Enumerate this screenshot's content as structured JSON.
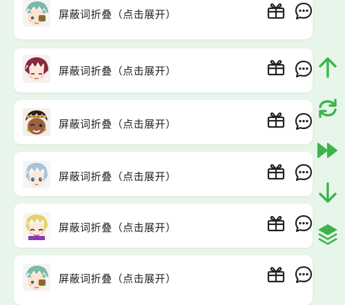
{
  "colors": {
    "background": "#e7f5ea",
    "card": "#ffffff",
    "accent_green": "#3cb44b",
    "icon_dark": "#222222"
  },
  "posts": [
    {
      "text": "屏蔽词折叠（点击展开）",
      "avatar": "teal-hair-avatar"
    },
    {
      "text": "屏蔽词折叠（点击展开）",
      "avatar": "red-hair-avatar"
    },
    {
      "text": "屏蔽词折叠（点击展开）",
      "avatar": "dark-skin-avatar"
    },
    {
      "text": "屏蔽词折叠（点击展开）",
      "avatar": "light-blue-hair-avatar"
    },
    {
      "text": "屏蔽词折叠（点击展开）",
      "avatar": "blonde-hair-avatar"
    },
    {
      "text": "屏蔽词折叠（点击展开）",
      "avatar": "teal-hair-avatar"
    }
  ],
  "actions": {
    "gift_icon": "gift-icon",
    "comment_icon": "comment-bubble-icon"
  },
  "sidebar": {
    "icons": [
      "arrow-up-icon",
      "refresh-icon",
      "fast-forward-icon",
      "arrow-down-icon",
      "layers-icon"
    ]
  }
}
